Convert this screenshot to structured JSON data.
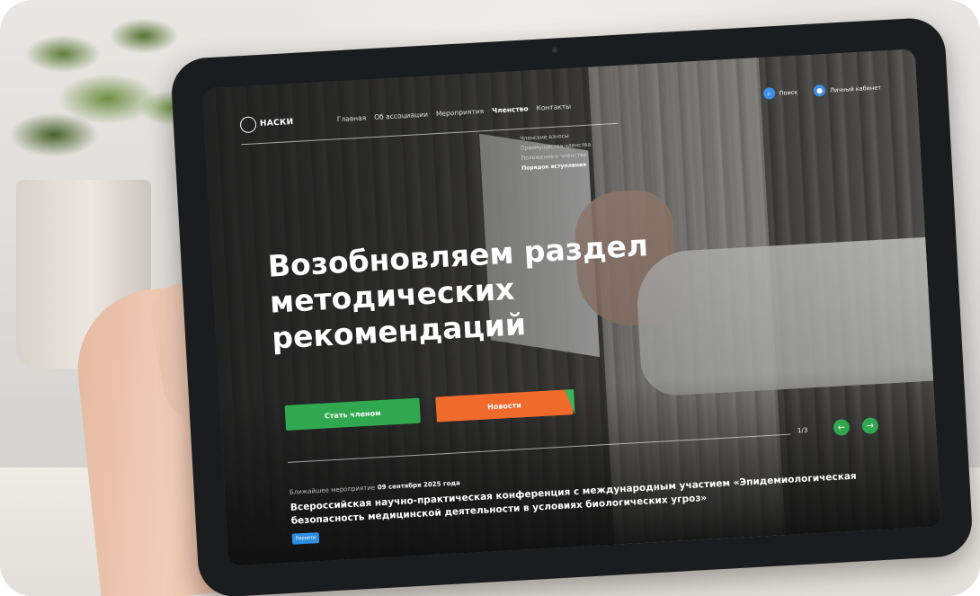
{
  "header": {
    "logo_text": "НАСКИ",
    "nav": [
      "Главная",
      "Об ассоциации",
      "Мероприятия",
      "Членство",
      "Контакты"
    ],
    "active_nav": "Членство",
    "search_label": "Поиск",
    "account_label": "Личный кабинет"
  },
  "dropdown": {
    "items": [
      "Членские взносы",
      "Преимущества членства",
      "Положение о членстве",
      "Порядок вступления"
    ],
    "selected": "Порядок вступления"
  },
  "hero": {
    "title": "Возобновляем раздел методических рекомендаций",
    "btn_member": "Стать членом",
    "btn_news": "Новости"
  },
  "slider": {
    "counter": "1/3",
    "prev_icon": "arrow-left-icon",
    "next_icon": "arrow-right-icon"
  },
  "event": {
    "label": "Ближайшее мероприятие",
    "date": "09 сентября 2025 года",
    "title": "Всероссийская научно-практическая конференция с международным участием «Эпидемиологическая безопасность медицинской деятельности в условиях биологических угроз»",
    "go_label": "Перейти"
  },
  "colors": {
    "green": "#2fa84f",
    "orange": "#ef6a2b",
    "blue": "#2f8ee0"
  }
}
